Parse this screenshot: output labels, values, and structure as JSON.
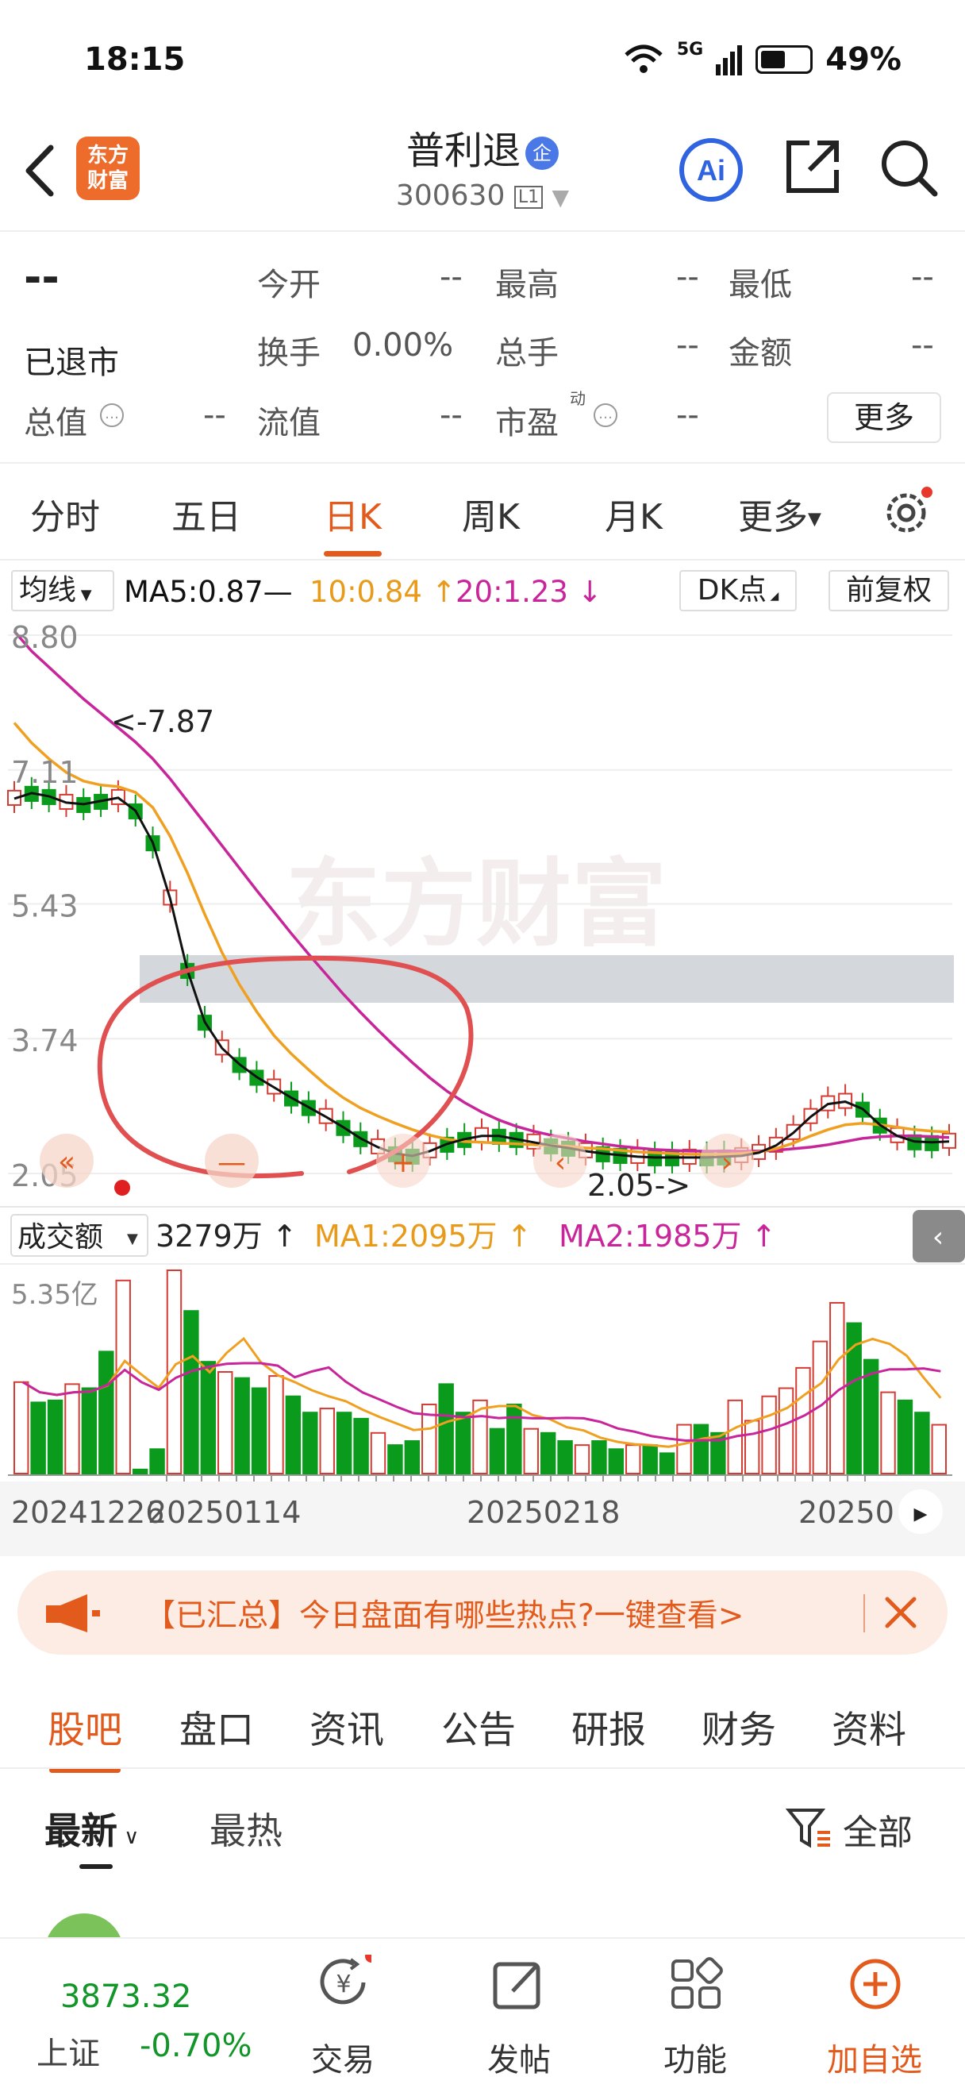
{
  "status_bar": {
    "time": "18:15",
    "network": "5G",
    "battery": "49%"
  },
  "header": {
    "app_logo_text": "东方财富",
    "stock_name": "普利退",
    "badge": "企",
    "stock_code": "300630",
    "level": "L1"
  },
  "quote": {
    "price": "--",
    "status": "已退市",
    "fields": [
      {
        "label": "今开",
        "value": "--"
      },
      {
        "label": "最高",
        "value": "--"
      },
      {
        "label": "最低",
        "value": "--"
      },
      {
        "label": "换手",
        "value": "0.00%"
      },
      {
        "label": "总手",
        "value": "--"
      },
      {
        "label": "金额",
        "value": "--"
      },
      {
        "label": "总值",
        "value": "--"
      },
      {
        "label": "流值",
        "value": "--"
      },
      {
        "label": "市盈",
        "value": "--"
      }
    ],
    "pe_superscript": "动",
    "more_label": "更多"
  },
  "period_tabs": [
    "分时",
    "五日",
    "日K",
    "周K",
    "月K",
    "更多"
  ],
  "active_tab": "日K",
  "ma_bar": {
    "selector": "均线",
    "ma5": "MA5:0.87—",
    "ma10": "10:0.84 ↑",
    "ma20": "20:1.23 ↓",
    "dk_label": "DK点",
    "adjust_label": "前复权"
  },
  "colors": {
    "accent": "#e35a1d",
    "up": "#d43c33",
    "down": "#0a9b1d",
    "ma5": "#111111",
    "ma10": "#f0a020",
    "ma20": "#c8259a",
    "circle": "#e05050"
  },
  "chart_data": [
    {
      "type": "candlestick",
      "y_ticks": [
        "8.80",
        "7.11",
        "5.43",
        "3.74",
        "2.05"
      ],
      "ylim": [
        2.05,
        8.8
      ],
      "annotations": [
        "<-7.87",
        "2.05->"
      ],
      "watermark": "东方财富",
      "series": [
        {
          "name": "MA5",
          "values": [
            6.75,
            6.82,
            6.78,
            6.7,
            6.68,
            6.72,
            6.76,
            6.6,
            6.2,
            5.5,
            4.6,
            3.95,
            3.62,
            3.42,
            3.26,
            3.13,
            3.0,
            2.88,
            2.76,
            2.63,
            2.49,
            2.38,
            2.3,
            2.27,
            2.33,
            2.42,
            2.48,
            2.52,
            2.52,
            2.48,
            2.44,
            2.4,
            2.37,
            2.33,
            2.3,
            2.28,
            2.26,
            2.25,
            2.25,
            2.25,
            2.25,
            2.26,
            2.27,
            2.31,
            2.4,
            2.56,
            2.76,
            2.92,
            2.95,
            2.86,
            2.66,
            2.52,
            2.45,
            2.44,
            2.45
          ]
        },
        {
          "name": "MA10",
          "values": [
            7.7,
            7.45,
            7.25,
            7.08,
            6.97,
            6.92,
            6.9,
            6.83,
            6.64,
            6.28,
            5.82,
            5.3,
            4.82,
            4.42,
            4.08,
            3.78,
            3.55,
            3.35,
            3.16,
            3.0,
            2.87,
            2.77,
            2.68,
            2.6,
            2.53,
            2.48,
            2.45,
            2.44,
            2.43,
            2.42,
            2.41,
            2.4,
            2.39,
            2.37,
            2.36,
            2.34,
            2.32,
            2.31,
            2.3,
            2.29,
            2.29,
            2.29,
            2.3,
            2.32,
            2.36,
            2.43,
            2.52,
            2.6,
            2.66,
            2.68,
            2.66,
            2.63,
            2.6,
            2.58,
            2.57
          ]
        },
        {
          "name": "MA20",
          "values": [
            8.85,
            8.6,
            8.4,
            8.2,
            8.0,
            7.82,
            7.64,
            7.46,
            7.25,
            7.0,
            6.72,
            6.44,
            6.16,
            5.88,
            5.6,
            5.33,
            5.06,
            4.8,
            4.55,
            4.3,
            4.07,
            3.85,
            3.64,
            3.44,
            3.25,
            3.08,
            2.94,
            2.82,
            2.72,
            2.64,
            2.58,
            2.53,
            2.49,
            2.45,
            2.42,
            2.39,
            2.37,
            2.35,
            2.34,
            2.33,
            2.33,
            2.33,
            2.33,
            2.33,
            2.34,
            2.36,
            2.38,
            2.41,
            2.45,
            2.49,
            2.51,
            2.52,
            2.52,
            2.51,
            2.5
          ]
        }
      ]
    },
    {
      "type": "bar",
      "title": "成交额",
      "value_text": "3279万 ↑",
      "ma1": "MA1:2095万 ↑",
      "ma2": "MA2:1985万 ↑",
      "y_max_label": "5.35亿",
      "x_tick_labels": [
        "20241226",
        "20250114",
        "20250218",
        "20250"
      ]
    }
  ],
  "banner": {
    "text": "【已汇总】今日盘面有哪些热点?一键查看>"
  },
  "bottom_tabs": [
    "股吧",
    "盘口",
    "资讯",
    "公告",
    "研报",
    "财务",
    "资料"
  ],
  "active_bottom_tab": "股吧",
  "sort": {
    "latest": "最新",
    "hot": "最热",
    "filter": "全部"
  },
  "bottom_nav": {
    "index_value": "3873.32",
    "index_name": "上证",
    "index_change": "-0.70%",
    "items": [
      "交易",
      "发帖",
      "功能",
      "加自选"
    ]
  }
}
